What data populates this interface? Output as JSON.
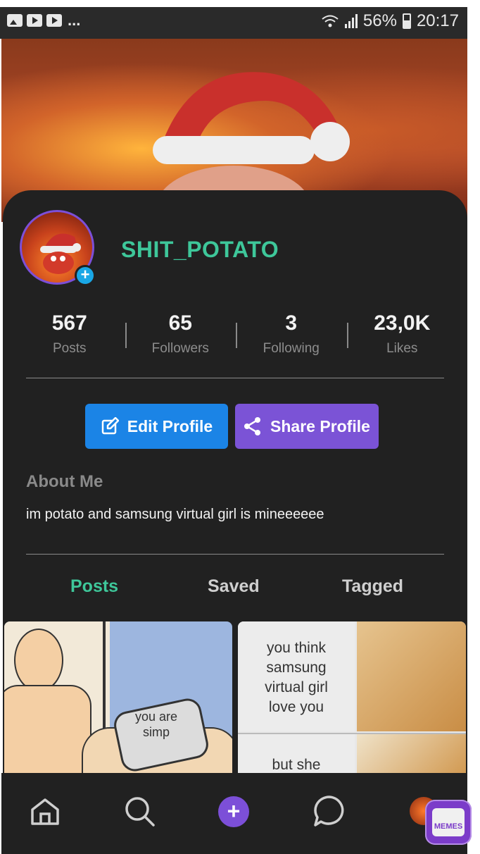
{
  "status_bar": {
    "battery": "56%",
    "time": "20:17",
    "dots": "..."
  },
  "profile": {
    "username": "SHIT_POTATO",
    "stats": [
      {
        "value": "567",
        "label": "Posts"
      },
      {
        "value": "65",
        "label": "Followers"
      },
      {
        "value": "3",
        "label": "Following"
      },
      {
        "value": "23,0K",
        "label": "Likes"
      }
    ],
    "edit_label": "Edit Profile",
    "share_label": "Share Profile",
    "about_title": "About Me",
    "about_text": "im potato and samsung virtual girl is mineeeeee"
  },
  "tabs": [
    {
      "label": "Posts",
      "active": true
    },
    {
      "label": "Saved",
      "active": false
    },
    {
      "label": "Tagged",
      "active": false
    }
  ],
  "posts": {
    "post1_text": "you are simp",
    "post2_text1": "you think samsung virtual girl love you",
    "post2_text2": "but she"
  },
  "memes_badge": "MEMES",
  "colors": {
    "accent_green": "#3ec79a",
    "edit_blue": "#1b84e6",
    "share_purple": "#7b53d6",
    "panel_bg": "#212121"
  }
}
